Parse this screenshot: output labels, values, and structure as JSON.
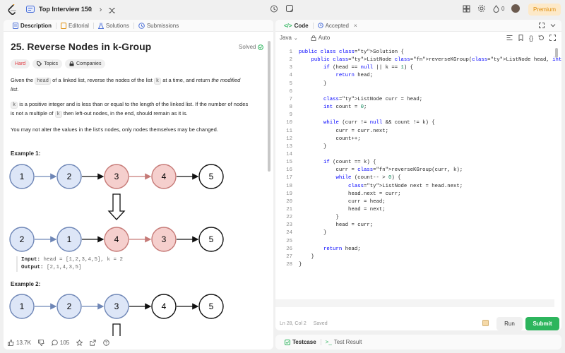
{
  "topbar": {
    "list_title": "Top Interview 150",
    "streak_count": "0",
    "premium_label": "Premium"
  },
  "left": {
    "tabs": [
      "Description",
      "Editorial",
      "Solutions",
      "Submissions"
    ],
    "title": "25. Reverse Nodes in k-Group",
    "solved_label": "Solved",
    "badges": {
      "difficulty": "Hard",
      "topics": "Topics",
      "companies": "Companies"
    },
    "desc": {
      "p1_a": "Given the ",
      "p1_code1": "head",
      "p1_b": " of a linked list, reverse the nodes of the list ",
      "p1_code2": "k",
      "p1_c": " at a time, and return ",
      "p1_em": "the modified list",
      "p1_d": ".",
      "p2_code": "k",
      "p2_a": " is a positive integer and is less than or equal to the length of the linked list. If the number of nodes is not a multiple of ",
      "p2_code2": "k",
      "p2_b": " then left-out nodes, in the end, should remain as it is.",
      "p3": "You may not alter the values in the list's nodes, only nodes themselves may be changed."
    },
    "example1": {
      "title": "Example 1:",
      "row1": [
        "1",
        "2",
        "3",
        "4",
        "5"
      ],
      "row2": [
        "2",
        "1",
        "4",
        "3",
        "5"
      ],
      "input_label": "Input:",
      "input_value": "head = [1,2,3,4,5], k = 2",
      "output_label": "Output:",
      "output_value": "[2,1,4,3,5]"
    },
    "example2": {
      "title": "Example 2:",
      "row1": [
        "1",
        "2",
        "3",
        "4",
        "5"
      ]
    },
    "footer": {
      "likes": "13.7K",
      "comments": "105"
    }
  },
  "editor": {
    "tabs": [
      "Code",
      "Accepted"
    ],
    "language": "Java",
    "autocomplete": "Auto",
    "lines": [
      "public class Solution {",
      "    public ListNode reverseKGroup(ListNode head, int k) {",
      "        if (head == null || k == 1) {",
      "            return head;",
      "        }",
      "",
      "        ListNode curr = head;",
      "        int count = 0;",
      "",
      "        while (curr != null && count != k) {",
      "            curr = curr.next;",
      "            count++;",
      "        }",
      "",
      "        if (count == k) {",
      "            curr = reverseKGroup(curr, k);",
      "            while (count-- > 0) {",
      "                ListNode next = head.next;",
      "                head.next = curr;",
      "                curr = head;",
      "                head = next;",
      "            }",
      "            head = curr;",
      "        }",
      "",
      "        return head;",
      "    }",
      "}"
    ],
    "status_position": "Ln 28, Col 2",
    "status_saved": "Saved",
    "run_label": "Run",
    "submit_label": "Submit"
  },
  "bottom": {
    "tabs": [
      "Testcase",
      "Test Result"
    ]
  },
  "colors": {
    "accent_green": "#2db55d",
    "hard_red": "#e0383e",
    "premium_orange": "#e08e0b",
    "node_blue": "#dde6f7",
    "node_red": "#f5cfcd"
  }
}
